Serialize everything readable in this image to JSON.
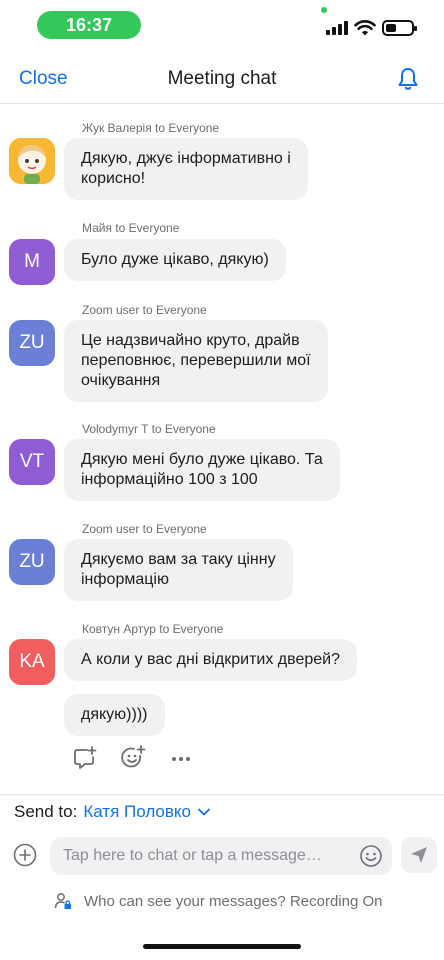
{
  "status_bar": {
    "time": "16:37"
  },
  "nav": {
    "close_label": "Close",
    "title": "Meeting chat",
    "bell_icon": "bell-icon"
  },
  "messages": [
    {
      "sender": "Жук Валерія to Everyone",
      "avatar_text": "",
      "avatar_color": "#f7b733",
      "lines": [
        "Дякую, джує інформативно і",
        "корисно!"
      ]
    },
    {
      "sender": "Майя to Everyone",
      "avatar_text": "M",
      "avatar_color": "#8e5cd3",
      "lines": [
        "Було дуже цікаво, дякую)"
      ]
    },
    {
      "sender": "Zoom user to Everyone",
      "avatar_text": "ZU",
      "avatar_color": "#6b7fd6",
      "lines": [
        "Це надзвичайно круто, драйв",
        "переповнює, перевершили мої",
        "очікування"
      ]
    },
    {
      "sender": "Volodymyr T to Everyone",
      "avatar_text": "VT",
      "avatar_color": "#8e5cd3",
      "lines": [
        "Дякую мені було дуже цікаво. Та",
        "інформаційно 100 з 100"
      ]
    },
    {
      "sender": "Zoom user to Everyone",
      "avatar_text": "ZU",
      "avatar_color": "#6b7fd6",
      "lines": [
        "Дякуємо вам за таку цінну",
        "інформацію"
      ]
    },
    {
      "sender": "Ковтун Артур to Everyone",
      "avatar_text": "KA",
      "avatar_color": "#f25e5e",
      "lines": [
        "А коли у вас дні відкритих дверей?"
      ]
    },
    {
      "sender": "",
      "avatar_text": "",
      "avatar_color": "",
      "lines": [
        "дякую))))"
      ]
    }
  ],
  "reactions": [
    "add-reply-icon",
    "add-emoji-reaction-icon",
    "more-icon"
  ],
  "send_to": {
    "label": "Send to:",
    "target": "Катя Половко"
  },
  "input": {
    "placeholder": "Tap here to chat or tap a message…"
  },
  "privacy": {
    "text": "Who can see your messages? Recording On"
  },
  "colors": {
    "accent": "#0e72ed",
    "bubble": "#f1f1f3",
    "status_green": "#34c759"
  }
}
